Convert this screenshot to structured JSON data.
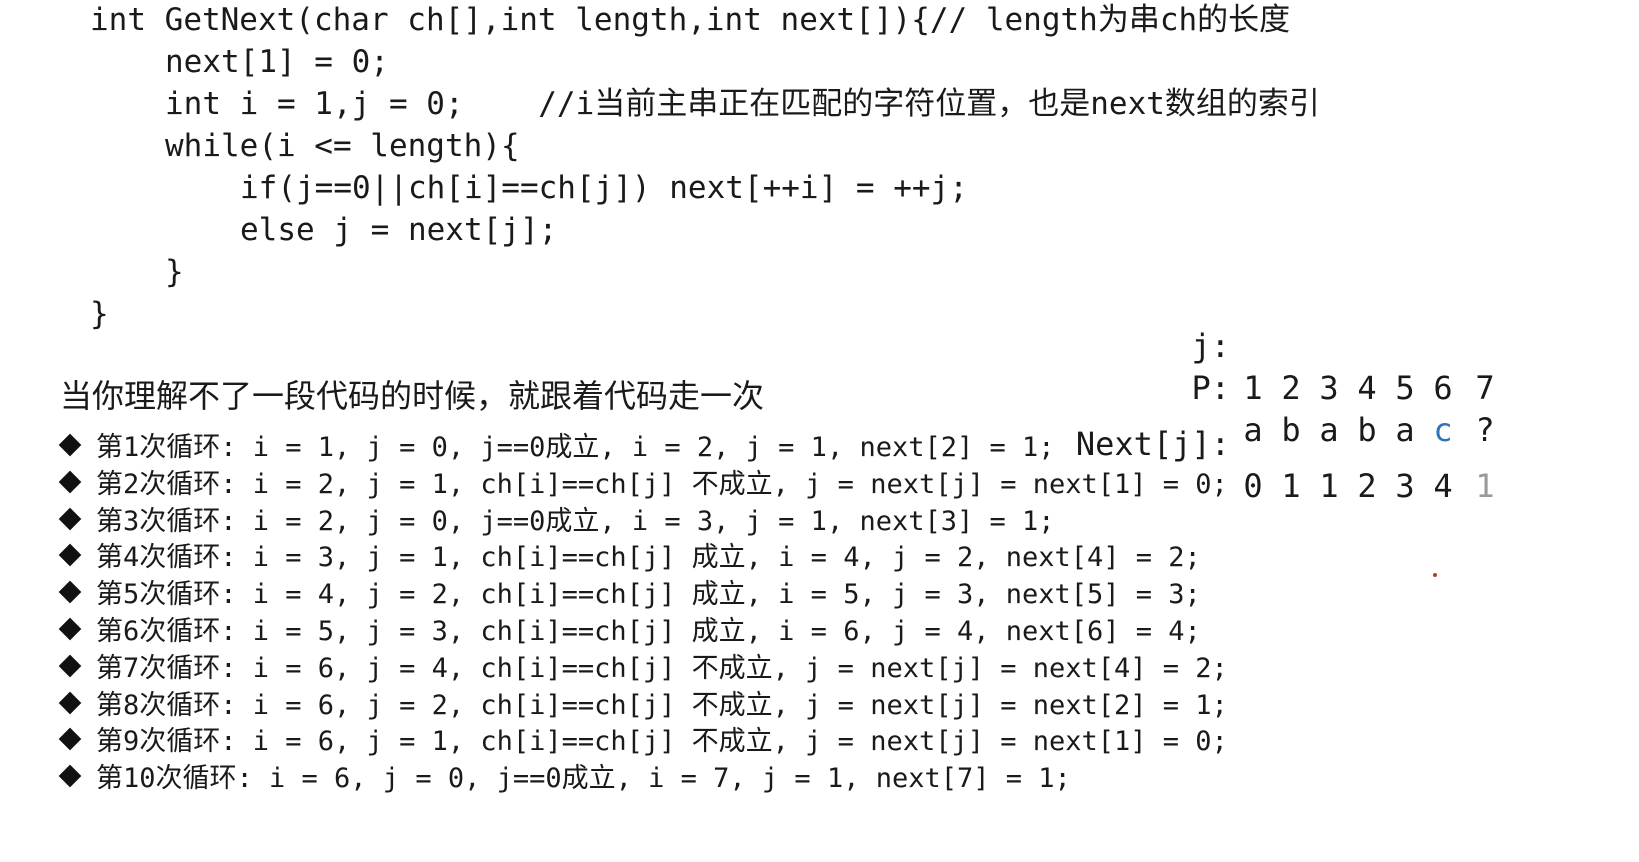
{
  "code": {
    "lines": [
      "int GetNext(char ch[],int length,int next[]){// length为串ch的长度",
      "next[1] = 0;",
      "int i = 1,j = 0;    //i当前主串正在匹配的字符位置，也是next数组的索引",
      "while(i <= length){",
      "if(j==0||ch[i]==ch[j]) next[++i] = ++j;",
      "else j = next[j];",
      "}",
      "}"
    ]
  },
  "tip": "当你理解不了一段代码的时候，就跟着代码走一次",
  "table": {
    "j_label": "j:",
    "p_label": "P:",
    "next_label": "Next[j]:",
    "j_values": [
      "1",
      "2",
      "3",
      "4",
      "5",
      "6",
      "7"
    ],
    "p_values": [
      "a",
      "b",
      "a",
      "b",
      "a",
      "c",
      "?"
    ],
    "next_values": [
      "0",
      "1",
      "1",
      "2",
      "3",
      "4",
      "1"
    ],
    "colors": {
      "highlight_char": "#2e75b6",
      "faded_value": "#9a9a9a",
      "text": "#1a1a1a"
    }
  },
  "steps": [
    "第1次循环: i = 1, j = 0, j==0成立, i = 2, j = 1, next[2] = 1;",
    "第2次循环: i = 2, j = 1, ch[i]==ch[j] 不成立, j = next[j] = next[1] = 0;",
    "第3次循环: i = 2, j = 0, j==0成立, i = 3, j = 1, next[3] = 1;",
    "第4次循环: i = 3, j = 1, ch[i]==ch[j] 成立, i = 4, j = 2, next[4] = 2;",
    "第5次循环: i = 4, j = 2, ch[i]==ch[j] 成立, i = 5, j = 3, next[5] = 3;",
    "第6次循环: i = 5, j = 3, ch[i]==ch[j] 成立, i = 6, j = 4, next[6] = 4;",
    "第7次循环: i = 6, j = 4, ch[i]==ch[j] 不成立, j = next[j] = next[4] = 2;",
    "第8次循环: i = 6, j = 2, ch[i]==ch[j] 不成立, j = next[j] = next[2] = 1;",
    "第9次循环: i = 6, j = 1, ch[i]==ch[j] 不成立, j = next[j] = next[1] = 0;",
    "第10次循环: i = 6, j = 0, j==0成立, i = 7, j = 1, next[7] = 1;"
  ]
}
